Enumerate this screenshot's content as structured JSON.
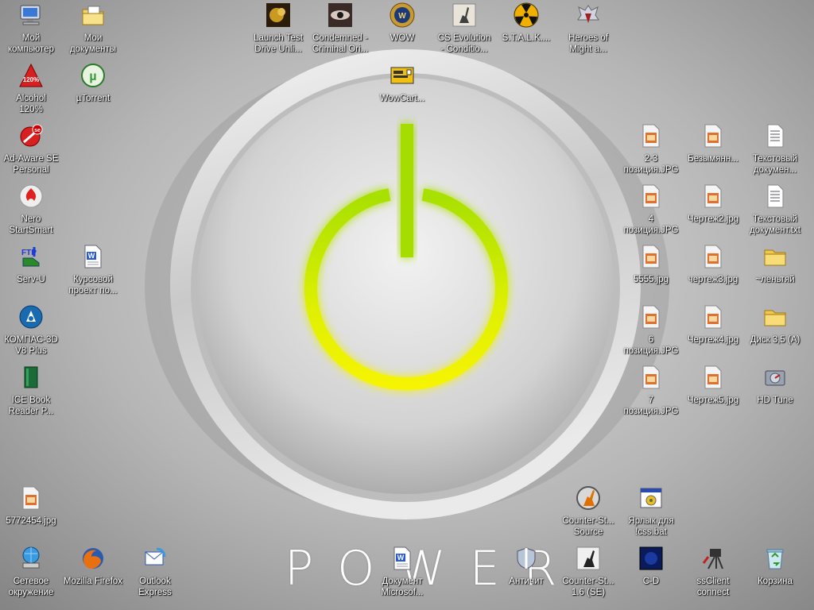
{
  "wallpaper": {
    "word": "POWER",
    "button_color": "#c8f000",
    "ring_color": "#f0f000"
  },
  "desktop": {
    "icons": [
      {
        "label": "Мой\nкомпьютер",
        "icon": "my-computer"
      },
      {
        "label": "Мои\nдокументы",
        "icon": "my-documents"
      },
      {
        "label": "Launch Test\nDrive Unli...",
        "icon": "test-drive"
      },
      {
        "label": "Condemned -\nCriminal Ori...",
        "icon": "condemned"
      },
      {
        "label": "WOW",
        "icon": "wow"
      },
      {
        "label": "CS Evolution\n- Conditio...",
        "icon": "cs-evolution"
      },
      {
        "label": "S.T.A.L.K....",
        "icon": "stalker"
      },
      {
        "label": "Heroes of\nMight a...",
        "icon": "heroes"
      },
      {
        "label": "Alcohol\n120%",
        "icon": "alcohol"
      },
      {
        "label": "µTorrent",
        "icon": "utorrent"
      },
      {
        "label": "WowCart...",
        "icon": "wowcart"
      },
      {
        "label": "Ad-Aware SE\nPersonal",
        "icon": "adaware"
      },
      {
        "label": "Nero\nStartSmart",
        "icon": "nero"
      },
      {
        "label": "Serv-U",
        "icon": "servu"
      },
      {
        "label": "Курсовой\nпроект по...",
        "icon": "word-doc"
      },
      {
        "label": "КОМПАС-3D\nV8 Plus",
        "icon": "kompas"
      },
      {
        "label": "ICE Book\nReader P...",
        "icon": "icebook"
      },
      {
        "label": "2-3\nпозиция.JPG",
        "icon": "jpg"
      },
      {
        "label": "Безымянн...",
        "icon": "jpg"
      },
      {
        "label": "Текстовый\nдокумен...",
        "icon": "txt"
      },
      {
        "label": "4\nпозиция.JPG",
        "icon": "jpg"
      },
      {
        "label": "Чертеж2.jpg",
        "icon": "jpg"
      },
      {
        "label": "Текстовый\nдокумент.txt",
        "icon": "txt"
      },
      {
        "label": "5555.jpg",
        "icon": "jpg"
      },
      {
        "label": "чертеж3.jpg",
        "icon": "jpg"
      },
      {
        "label": "~леньтяй",
        "icon": "folder"
      },
      {
        "label": "6\nпозиция.JPG",
        "icon": "jpg"
      },
      {
        "label": "Чертеж4.jpg",
        "icon": "jpg"
      },
      {
        "label": "Диск 3,5 (A)",
        "icon": "folder"
      },
      {
        "label": "7\nпозиция.JPG",
        "icon": "jpg"
      },
      {
        "label": "Чертеж5.jpg",
        "icon": "jpg"
      },
      {
        "label": "HD Tune",
        "icon": "hdtune"
      },
      {
        "label": "5772454.jpg",
        "icon": "jpg"
      },
      {
        "label": "Counter-St...\nSource",
        "icon": "cs-source"
      },
      {
        "label": "Ярлык для\n!css.bat",
        "icon": "bat"
      },
      {
        "label": "Сетевое\nокружение",
        "icon": "network"
      },
      {
        "label": "Mozilla Firefox",
        "icon": "firefox"
      },
      {
        "label": "Outlook\nExpress",
        "icon": "outlook"
      },
      {
        "label": "Документ\nMicrosof...",
        "icon": "word-doc"
      },
      {
        "label": "Античит",
        "icon": "anticheat"
      },
      {
        "label": "Counter-St...\n1.6 (SE)",
        "icon": "cs16"
      },
      {
        "label": "C-D",
        "icon": "cd"
      },
      {
        "label": "ssClient\nconnect",
        "icon": "ssclient"
      },
      {
        "label": "Корзина",
        "icon": "recycle-bin"
      }
    ]
  }
}
